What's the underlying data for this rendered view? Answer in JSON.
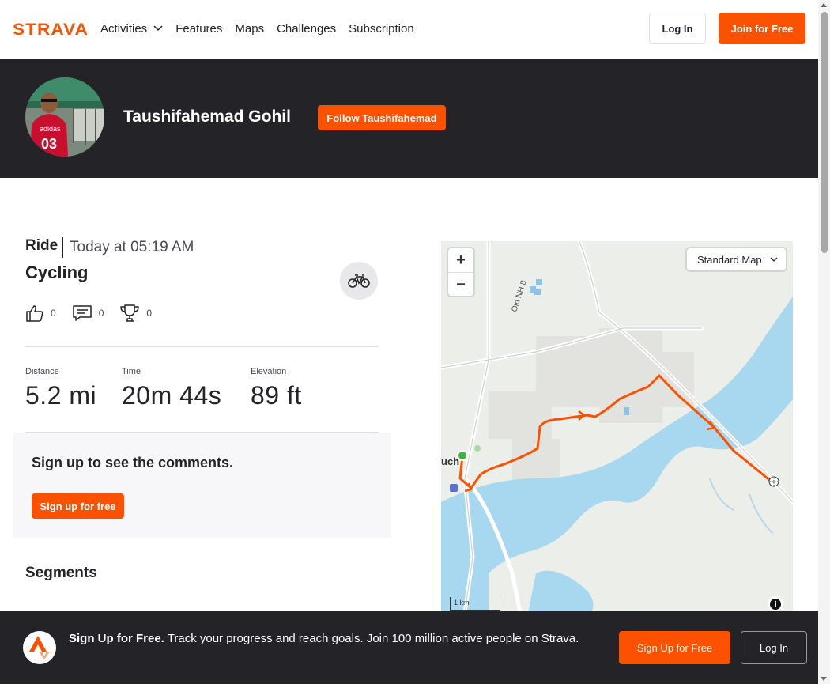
{
  "nav": {
    "brand": "STRAVA",
    "links": [
      "Activities",
      "Features",
      "Maps",
      "Challenges",
      "Subscription"
    ],
    "login_label": "Log In",
    "join_label": "Join for Free"
  },
  "athlete": {
    "name": "Taushifahemad Gohil",
    "follow_label": "Follow Taushifahemad"
  },
  "activity": {
    "type": "Ride",
    "time": "Today at 05:19 AM",
    "title": "Cycling",
    "kudos_count": "0",
    "comments_count": "0",
    "achievements_count": "0",
    "stats": [
      {
        "label": "Distance",
        "value": "5.2 mi"
      },
      {
        "label": "Time",
        "value": "20m 44s"
      },
      {
        "label": "Elevation",
        "value": "89 ft"
      }
    ]
  },
  "comments": {
    "heading": "Sign up to see the comments.",
    "button_label": "Sign up for free"
  },
  "segments": {
    "heading": "Segments"
  },
  "map": {
    "style_label": "Standard Map",
    "zoom_in": "+",
    "zoom_out": "−",
    "scale_label": "1 km",
    "road_label": "Old NH 8",
    "place_label": "uch",
    "route_color": "#fc5200",
    "water_color": "#a8d8f0"
  },
  "bottom_banner": {
    "headline": "Sign Up for Free.",
    "body": "Track your progress and reach goals. Join 100 million active people on Strava.",
    "signup_label": "Sign Up for Free",
    "login_label": "Log In"
  },
  "colors": {
    "brand": "#fc5200",
    "dark": "#242428"
  }
}
